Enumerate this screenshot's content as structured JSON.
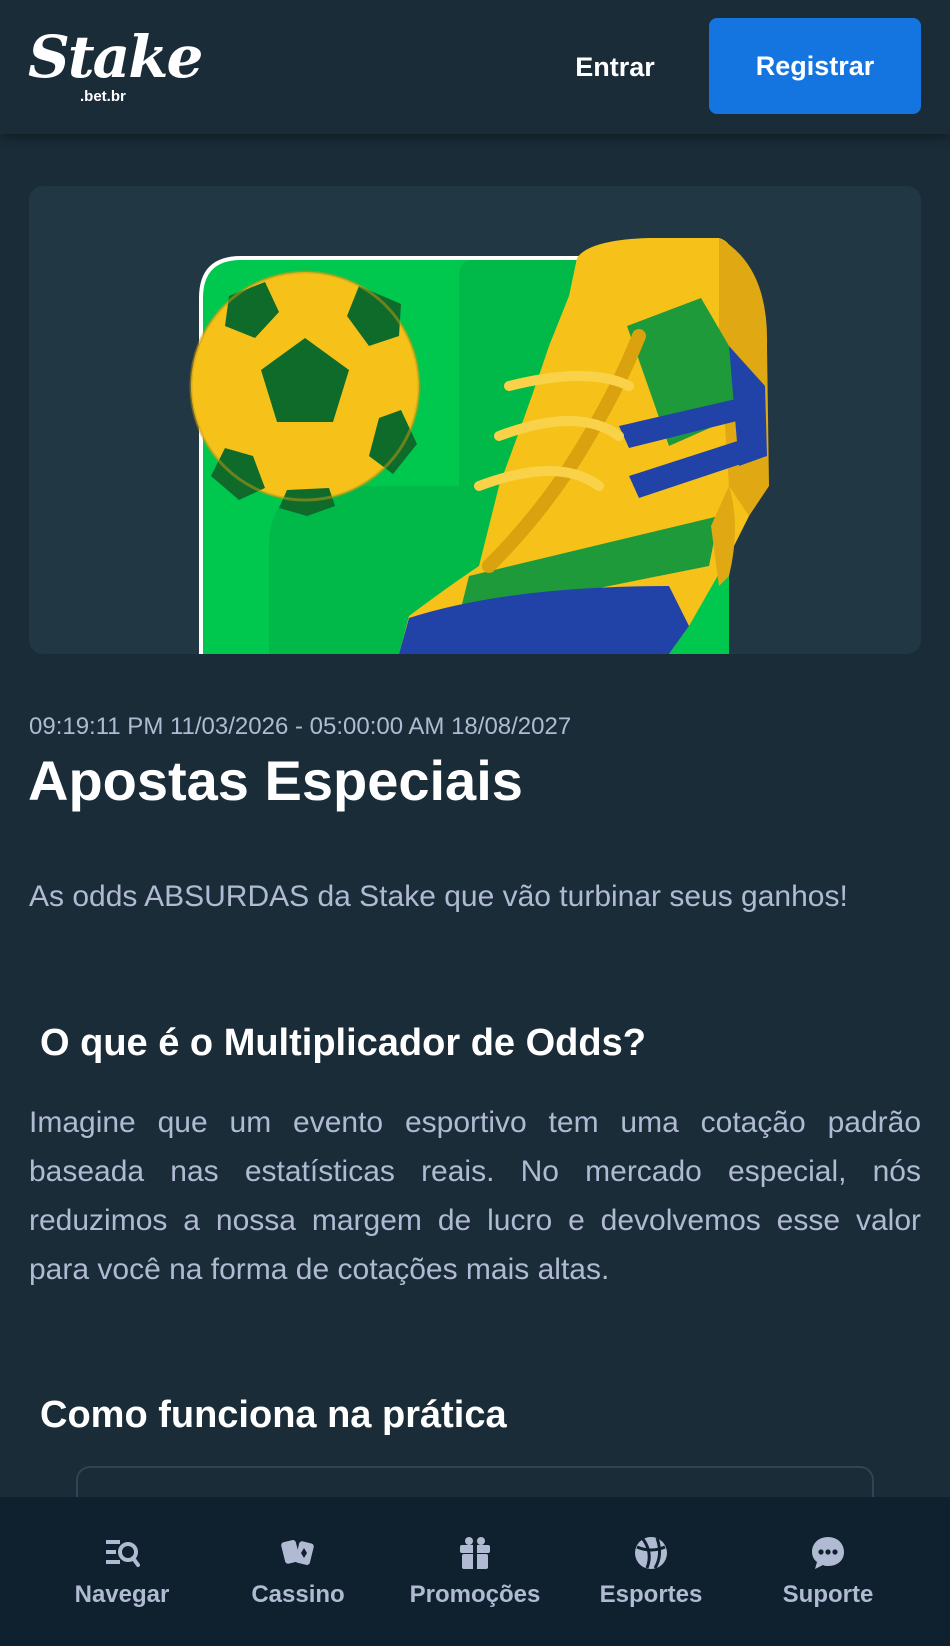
{
  "header": {
    "logo_text": "Stake",
    "logo_sub": ".bet.br",
    "login_label": "Entrar",
    "register_label": "Registrar"
  },
  "promo": {
    "date_range": "09:19:11 PM 11/03/2026 - 05:00:00 AM 18/08/2027",
    "title": "Apostas Especiais",
    "intro": " As odds ABSURDAS da Stake que vão turbinar seus ganhos!",
    "section1_heading": "O que é o Multiplicador de Odds?",
    "section1_body": " Imagine que um evento esportivo tem uma cotação padrão baseada nas estatísticas reais. No mercado especial, nós reduzimos a nossa margem de lucro e devolvemos esse valor para você na forma de cotações mais altas.",
    "section2_heading": "Como funciona na prática"
  },
  "bottom_nav": {
    "items": [
      {
        "label": "Navegar",
        "icon": "browse-icon"
      },
      {
        "label": "Cassino",
        "icon": "cards-icon"
      },
      {
        "label": "Promoções",
        "icon": "gift-icon"
      },
      {
        "label": "Esportes",
        "icon": "ball-icon"
      },
      {
        "label": "Suporte",
        "icon": "chat-icon"
      }
    ]
  },
  "colors": {
    "background": "#1a2c38",
    "nav_background": "#0f212e",
    "accent_blue": "#1475e1",
    "muted_text": "#b1bad3",
    "banner_green": "#00c74d",
    "banner_yellow": "#f6c21a",
    "banner_blue": "#2143a8"
  }
}
